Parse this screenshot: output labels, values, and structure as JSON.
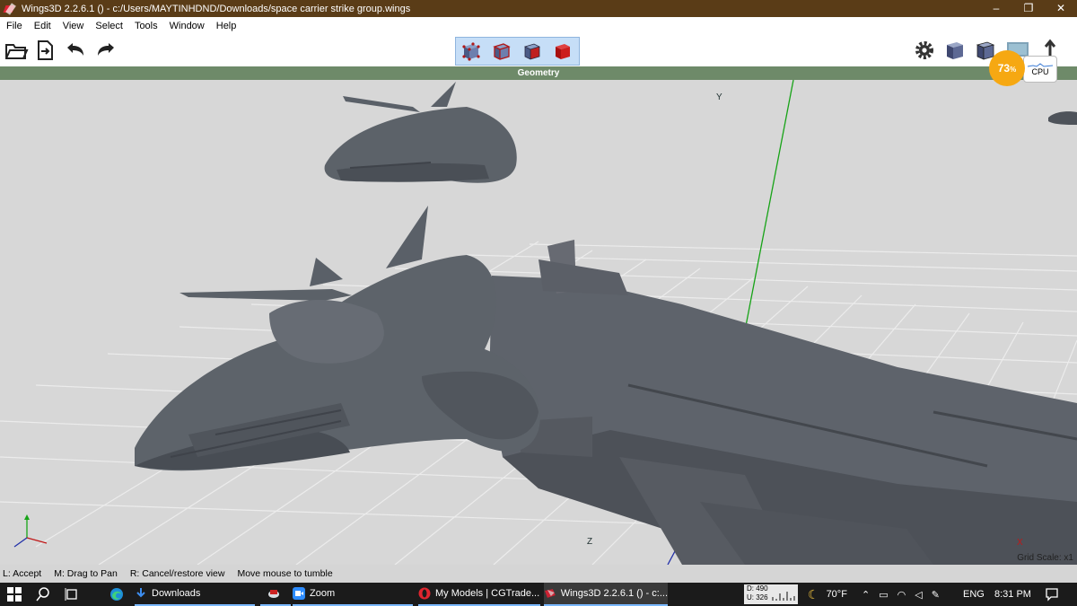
{
  "window": {
    "title": "Wings3D 2.2.6.1 () - c:/Users/MAYTINHDND/Downloads/space carrier strike group.wings",
    "controls": [
      "–",
      "❐",
      "✕"
    ]
  },
  "menu": {
    "items": [
      "File",
      "Edit",
      "View",
      "Select",
      "Tools",
      "Window",
      "Help"
    ]
  },
  "toolbar": {
    "left_icons": [
      "open-folder-icon",
      "import-icon",
      "undo-icon",
      "redo-icon"
    ],
    "selection_modes": [
      "vertex-mode",
      "edge-mode",
      "face-mode",
      "body-mode"
    ],
    "right_icons": [
      "gear-icon",
      "cube-smooth-icon",
      "cube-flat-icon",
      "screen-icon",
      "axis-arrow-icon"
    ]
  },
  "geometry_bar": {
    "label": "Geometry"
  },
  "cpu_widget": {
    "percent": "73",
    "percent_sign": "%",
    "label": "CPU"
  },
  "viewport": {
    "axis_y": "Y",
    "axis_z": "Z",
    "axis_x": "X",
    "grid_scale": "Grid Scale: x1",
    "colors": {
      "background": "#d7d7d7",
      "grid": "#eeeeee",
      "model": "#5f6670",
      "y_axis": "#17a317",
      "z_axis": "#2230a8",
      "x_axis": "#c01818"
    }
  },
  "status": {
    "items": [
      "L: Accept",
      "M: Drag to Pan",
      "R: Cancel/restore view",
      "Move mouse to tumble"
    ]
  },
  "taskbar": {
    "apps": [
      {
        "label": "Downloads",
        "icon": "download-arrow-icon"
      },
      {
        "label": "",
        "icon": "ocr-app-icon"
      },
      {
        "label": "Zoom",
        "icon": "zoom-icon"
      },
      {
        "label": "My Models | CGTrade...",
        "icon": "opera-icon"
      },
      {
        "label": "Wings3D 2.2.6.1 () - c:...",
        "icon": "wings3d-icon"
      }
    ],
    "netmon": {
      "down": "D: 490",
      "up": "U: 326"
    },
    "weather": "70°F",
    "language": "ENG",
    "time": "8:31 PM"
  }
}
